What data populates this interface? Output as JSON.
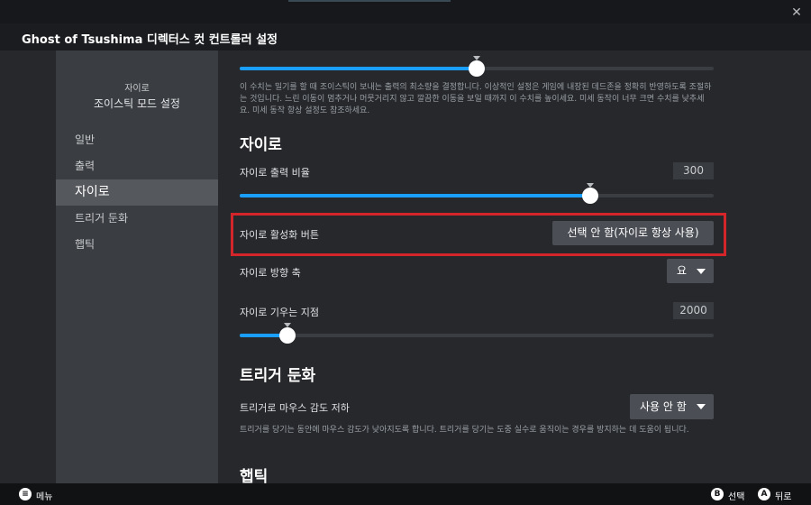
{
  "window": {
    "title": "Ghost of Tsushima 디렉터스 컷 컨트롤러 설정",
    "close_glyph": "✕"
  },
  "sidebar": {
    "subtitle": "자이로",
    "title": "조이스틱 모드 설정",
    "items": [
      {
        "label": "일반"
      },
      {
        "label": "출력"
      },
      {
        "label": "자이로"
      },
      {
        "label": "트리거 둔화"
      },
      {
        "label": "햅틱"
      }
    ],
    "active_item": "자이로"
  },
  "main": {
    "top_slider": {
      "level_percent": 50
    },
    "top_description": "이 수치는 밀기를 할 때 조이스틱이 보내는 출력의 최소량을 결정합니다. 이상적인 설정은 게임에 내장된 데드존을 정확히 반영하도록 조절하는 것입니다. 느린 이동이 멈추거나 머뭇거리지 않고 깔끔한 이동을 보일 때까지 이 수치를 높이세요. 미세 동작이 너무 크면 수치를 낮추세요. 미세 동작 항상 설정도 참조하세요.",
    "gyro_section": {
      "title": "자이로",
      "output_ratio": {
        "label": "자이로 출력 비율",
        "value": "300",
        "level_percent": 74
      },
      "activation_button": {
        "label": "자이로 활성화 버튼",
        "button_label": "선택 안 함(자이로 항상 사용)"
      },
      "direction_axis": {
        "label": "자이로 방향 축",
        "selected": "요"
      },
      "tilt_point": {
        "label": "자이로 기우는 지점",
        "value": "2000",
        "level_percent": 10
      }
    },
    "trigger_section": {
      "title": "트리거 둔화",
      "mouse_sensitivity": {
        "label": "트리거로 마우스 감도 저하",
        "selected": "사용 안 함"
      },
      "description": "트리거를 당기는 동안에 마우스 감도가 낮아지도록 합니다. 트리거를 당기는 도중 실수로 움직이는 경우를 방지하는 데 도움이 됩니다."
    },
    "haptic_section": {
      "title": "햅틱"
    }
  },
  "bottom_bar": {
    "menu": {
      "glyph": "≡",
      "label": "메뉴"
    },
    "select": {
      "glyph": "B",
      "label": "선택"
    },
    "back": {
      "glyph": "A",
      "label": "뒤로"
    }
  },
  "colors": {
    "accent": "#1a9fff",
    "highlight_border": "#d4252a",
    "sidebar_bg": "#3a3d42",
    "content_bg": "#26282c"
  }
}
